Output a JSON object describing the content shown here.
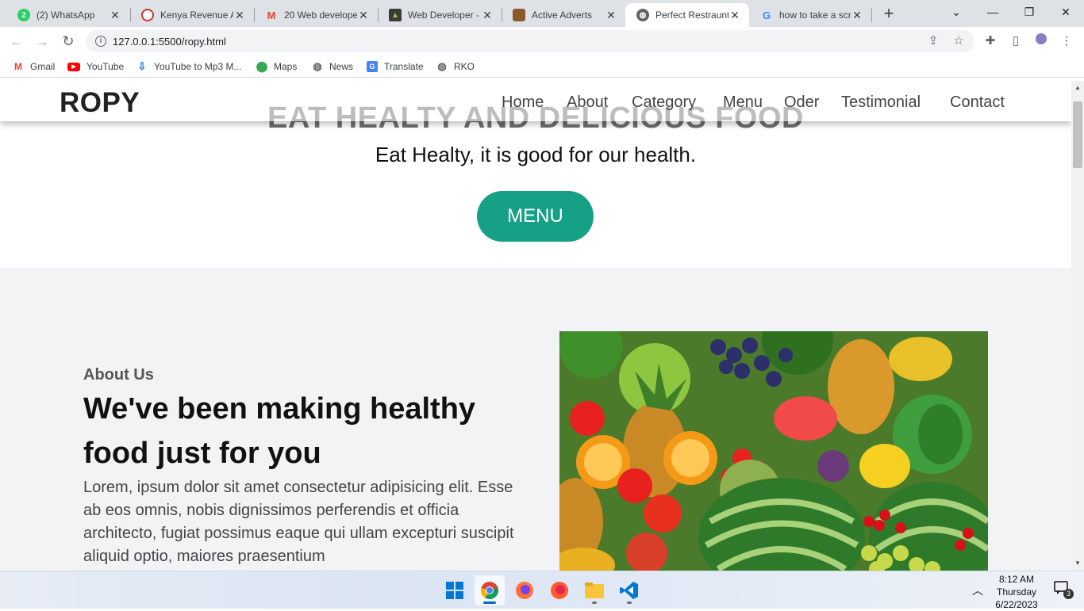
{
  "browser": {
    "tabs": [
      {
        "title": "(2) WhatsApp",
        "icon": "whatsapp-icon"
      },
      {
        "title": "Kenya Revenue A",
        "icon": "kra-icon"
      },
      {
        "title": "20 Web develope",
        "icon": "gmail-icon"
      },
      {
        "title": "Web Developer -",
        "icon": "android-icon"
      },
      {
        "title": "Active Adverts",
        "icon": "kenya-emblem-icon"
      },
      {
        "title": "Perfect Restraunt",
        "icon": "globe-icon",
        "active": true
      },
      {
        "title": "how to take a scr",
        "icon": "google-icon"
      }
    ],
    "url": "127.0.0.1:5500/ropy.html",
    "bookmarks": [
      {
        "label": "Gmail",
        "icon": "gmail-icon"
      },
      {
        "label": "YouTube",
        "icon": "youtube-icon"
      },
      {
        "label": "YouTube to Mp3 M...",
        "icon": "download-icon"
      },
      {
        "label": "Maps",
        "icon": "maps-icon"
      },
      {
        "label": "News",
        "icon": "globe-icon"
      },
      {
        "label": "Translate",
        "icon": "translate-icon"
      },
      {
        "label": "RKO",
        "icon": "globe-icon"
      }
    ]
  },
  "site": {
    "logo": "ROPY",
    "nav": [
      "Home",
      "About",
      "Category",
      "Menu",
      "Oder",
      "Testimonial",
      "Contact"
    ],
    "hero": {
      "heading": "EAT HEALTY AND DELICIOUS FOOD",
      "subheading": "Eat Healty, it is good for our health.",
      "button": "MENU",
      "button_color": "#16a085"
    },
    "about": {
      "kicker": "About Us",
      "title": "We've been making healthy food just for you",
      "text": "Lorem, ipsum dolor sit amet consectetur adipisicing elit. Esse ab eos omnis, nobis dignissimos perferendis et officia architecto, fugiat possimus eaque qui ullam excepturi suscipit aliquid optio, maiores praesentium"
    }
  },
  "taskbar": {
    "time": "8:12 AM",
    "day": "Thursday",
    "date": "6/22/2023",
    "notification_count": "3",
    "apps": [
      "windows-start-icon",
      "chrome-icon",
      "firefox-icon",
      "firefox-icon",
      "file-explorer-icon",
      "vscode-icon"
    ]
  }
}
